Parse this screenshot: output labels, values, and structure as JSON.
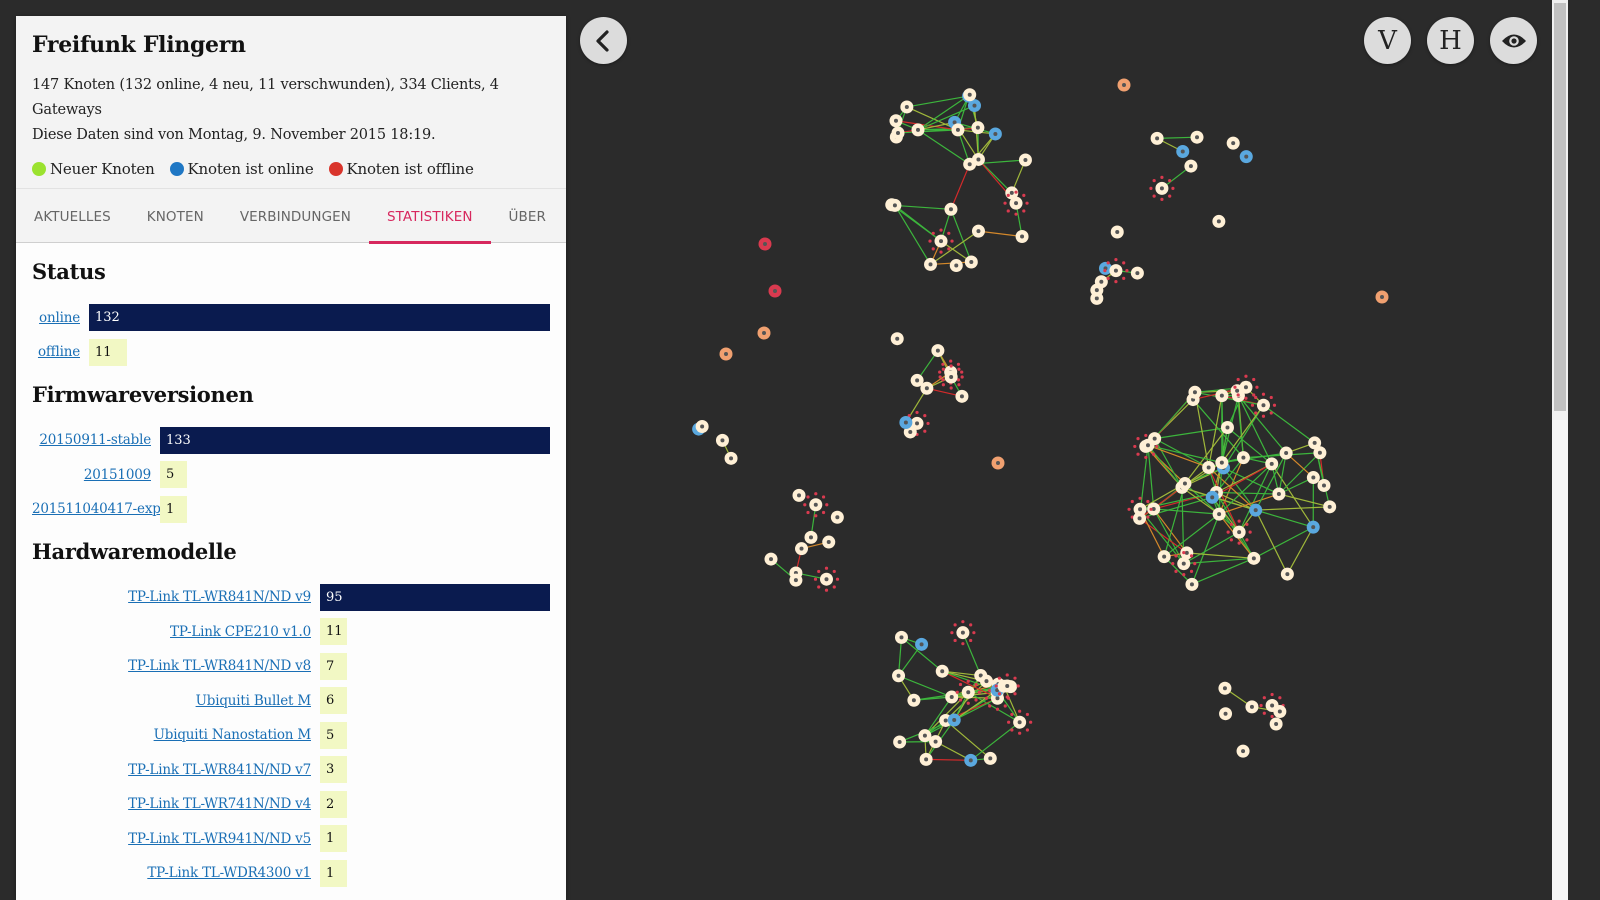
{
  "sidebar": {
    "title": "Freifunk Flingern",
    "summary_line": "147 Knoten (132 online, 4 neu, 11 verschwunden), 334 Clients, 4 Gateways",
    "date_line": "Diese Daten sind von Montag, 9. November 2015 18:19.",
    "legend": [
      {
        "label": "Neuer Knoten",
        "color": "#9be22f"
      },
      {
        "label": "Knoten ist online",
        "color": "#1f77c4"
      },
      {
        "label": "Knoten ist offline",
        "color": "#d9342b"
      }
    ],
    "tabs": [
      {
        "label": "AKTUELLES",
        "active": false
      },
      {
        "label": "KNOTEN",
        "active": false
      },
      {
        "label": "VERBINDUNGEN",
        "active": false
      },
      {
        "label": "STATISTIKEN",
        "active": true
      },
      {
        "label": "ÜBER",
        "active": false
      }
    ]
  },
  "statistics": {
    "status": {
      "heading": "Status",
      "rows": [
        {
          "label": "online",
          "value": "132",
          "fraction": 1.0
        },
        {
          "label": "offline",
          "value": "11",
          "fraction": 0.0833
        }
      ]
    },
    "firmware": {
      "heading": "Firmwareversionen",
      "rows": [
        {
          "label": "20150911-stable",
          "value": "133",
          "fraction": 1.0
        },
        {
          "label": "20151009",
          "value": "5",
          "fraction": 0.0376
        },
        {
          "label": "201511040417-exp",
          "value": "1",
          "fraction": 0.0075
        }
      ]
    },
    "hardware": {
      "heading": "Hardwaremodelle",
      "rows": [
        {
          "label": "TP-Link TL-WR841N/ND v9",
          "value": "95",
          "fraction": 1.0
        },
        {
          "label": "TP-Link CPE210 v1.0",
          "value": "11",
          "fraction": 0.1158
        },
        {
          "label": "TP-Link TL-WR841N/ND v8",
          "value": "7",
          "fraction": 0.0737
        },
        {
          "label": "Ubiquiti Bullet M",
          "value": "6",
          "fraction": 0.0632
        },
        {
          "label": "Ubiquiti Nanostation M",
          "value": "5",
          "fraction": 0.0526
        },
        {
          "label": "TP-Link TL-WR841N/ND v7",
          "value": "3",
          "fraction": 0.0316
        },
        {
          "label": "TP-Link TL-WR741N/ND v4",
          "value": "2",
          "fraction": 0.0211
        },
        {
          "label": "TP-Link TL-WR941N/ND v5",
          "value": "1",
          "fraction": 0.0105
        },
        {
          "label": "TP-Link TL-WDR4300 v1",
          "value": "1",
          "fraction": 0.0105
        }
      ]
    }
  },
  "controls": {
    "back_icon": "chevron-left-icon",
    "vertical_label": "V",
    "horizontal_label": "H",
    "view_icon": "eye-icon"
  },
  "colors": {
    "background": "#2b2b2b",
    "node_fill": "#fff0d6",
    "node_online": "#5aa8df",
    "node_offline": "#d93a4f",
    "node_lost": "#f0a070",
    "link_good": "#3cb53c",
    "link_medium": "#a0b83a",
    "link_fair": "#d4882a",
    "link_bad": "#d42a2a",
    "accent": "#d7285e",
    "bar_dark": "#0a1b4f",
    "bar_light": "#f2f8c4"
  }
}
